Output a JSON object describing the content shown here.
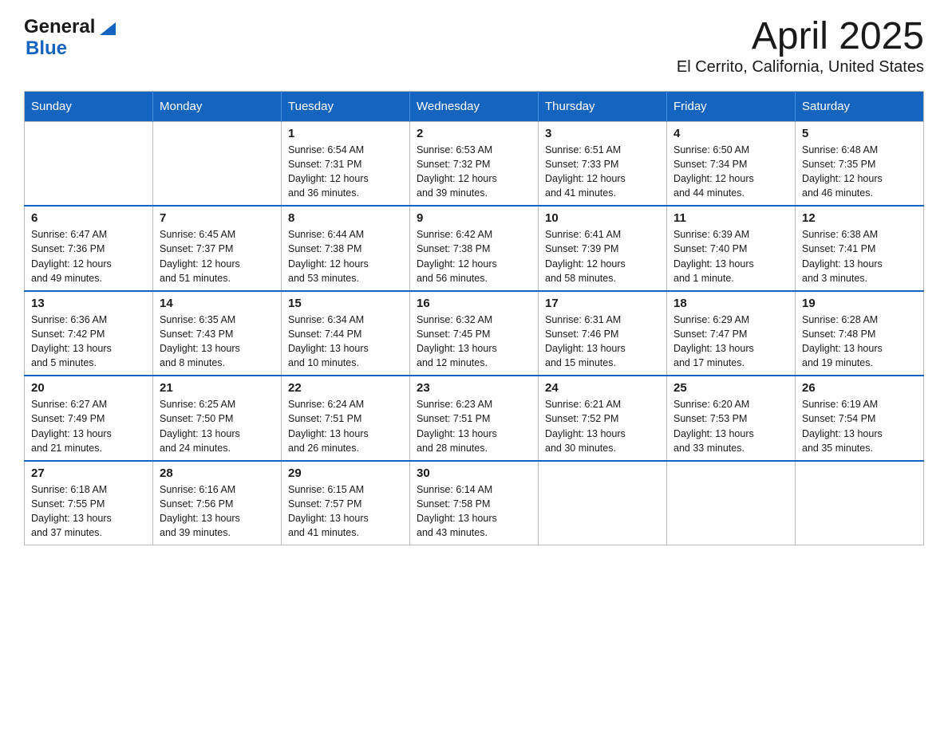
{
  "header": {
    "logo_general": "General",
    "logo_blue": "Blue",
    "title": "April 2025",
    "subtitle": "El Cerrito, California, United States"
  },
  "days_of_week": [
    "Sunday",
    "Monday",
    "Tuesday",
    "Wednesday",
    "Thursday",
    "Friday",
    "Saturday"
  ],
  "weeks": [
    [
      {
        "day": "",
        "info": ""
      },
      {
        "day": "",
        "info": ""
      },
      {
        "day": "1",
        "info": "Sunrise: 6:54 AM\nSunset: 7:31 PM\nDaylight: 12 hours\nand 36 minutes."
      },
      {
        "day": "2",
        "info": "Sunrise: 6:53 AM\nSunset: 7:32 PM\nDaylight: 12 hours\nand 39 minutes."
      },
      {
        "day": "3",
        "info": "Sunrise: 6:51 AM\nSunset: 7:33 PM\nDaylight: 12 hours\nand 41 minutes."
      },
      {
        "day": "4",
        "info": "Sunrise: 6:50 AM\nSunset: 7:34 PM\nDaylight: 12 hours\nand 44 minutes."
      },
      {
        "day": "5",
        "info": "Sunrise: 6:48 AM\nSunset: 7:35 PM\nDaylight: 12 hours\nand 46 minutes."
      }
    ],
    [
      {
        "day": "6",
        "info": "Sunrise: 6:47 AM\nSunset: 7:36 PM\nDaylight: 12 hours\nand 49 minutes."
      },
      {
        "day": "7",
        "info": "Sunrise: 6:45 AM\nSunset: 7:37 PM\nDaylight: 12 hours\nand 51 minutes."
      },
      {
        "day": "8",
        "info": "Sunrise: 6:44 AM\nSunset: 7:38 PM\nDaylight: 12 hours\nand 53 minutes."
      },
      {
        "day": "9",
        "info": "Sunrise: 6:42 AM\nSunset: 7:38 PM\nDaylight: 12 hours\nand 56 minutes."
      },
      {
        "day": "10",
        "info": "Sunrise: 6:41 AM\nSunset: 7:39 PM\nDaylight: 12 hours\nand 58 minutes."
      },
      {
        "day": "11",
        "info": "Sunrise: 6:39 AM\nSunset: 7:40 PM\nDaylight: 13 hours\nand 1 minute."
      },
      {
        "day": "12",
        "info": "Sunrise: 6:38 AM\nSunset: 7:41 PM\nDaylight: 13 hours\nand 3 minutes."
      }
    ],
    [
      {
        "day": "13",
        "info": "Sunrise: 6:36 AM\nSunset: 7:42 PM\nDaylight: 13 hours\nand 5 minutes."
      },
      {
        "day": "14",
        "info": "Sunrise: 6:35 AM\nSunset: 7:43 PM\nDaylight: 13 hours\nand 8 minutes."
      },
      {
        "day": "15",
        "info": "Sunrise: 6:34 AM\nSunset: 7:44 PM\nDaylight: 13 hours\nand 10 minutes."
      },
      {
        "day": "16",
        "info": "Sunrise: 6:32 AM\nSunset: 7:45 PM\nDaylight: 13 hours\nand 12 minutes."
      },
      {
        "day": "17",
        "info": "Sunrise: 6:31 AM\nSunset: 7:46 PM\nDaylight: 13 hours\nand 15 minutes."
      },
      {
        "day": "18",
        "info": "Sunrise: 6:29 AM\nSunset: 7:47 PM\nDaylight: 13 hours\nand 17 minutes."
      },
      {
        "day": "19",
        "info": "Sunrise: 6:28 AM\nSunset: 7:48 PM\nDaylight: 13 hours\nand 19 minutes."
      }
    ],
    [
      {
        "day": "20",
        "info": "Sunrise: 6:27 AM\nSunset: 7:49 PM\nDaylight: 13 hours\nand 21 minutes."
      },
      {
        "day": "21",
        "info": "Sunrise: 6:25 AM\nSunset: 7:50 PM\nDaylight: 13 hours\nand 24 minutes."
      },
      {
        "day": "22",
        "info": "Sunrise: 6:24 AM\nSunset: 7:51 PM\nDaylight: 13 hours\nand 26 minutes."
      },
      {
        "day": "23",
        "info": "Sunrise: 6:23 AM\nSunset: 7:51 PM\nDaylight: 13 hours\nand 28 minutes."
      },
      {
        "day": "24",
        "info": "Sunrise: 6:21 AM\nSunset: 7:52 PM\nDaylight: 13 hours\nand 30 minutes."
      },
      {
        "day": "25",
        "info": "Sunrise: 6:20 AM\nSunset: 7:53 PM\nDaylight: 13 hours\nand 33 minutes."
      },
      {
        "day": "26",
        "info": "Sunrise: 6:19 AM\nSunset: 7:54 PM\nDaylight: 13 hours\nand 35 minutes."
      }
    ],
    [
      {
        "day": "27",
        "info": "Sunrise: 6:18 AM\nSunset: 7:55 PM\nDaylight: 13 hours\nand 37 minutes."
      },
      {
        "day": "28",
        "info": "Sunrise: 6:16 AM\nSunset: 7:56 PM\nDaylight: 13 hours\nand 39 minutes."
      },
      {
        "day": "29",
        "info": "Sunrise: 6:15 AM\nSunset: 7:57 PM\nDaylight: 13 hours\nand 41 minutes."
      },
      {
        "day": "30",
        "info": "Sunrise: 6:14 AM\nSunset: 7:58 PM\nDaylight: 13 hours\nand 43 minutes."
      },
      {
        "day": "",
        "info": ""
      },
      {
        "day": "",
        "info": ""
      },
      {
        "day": "",
        "info": ""
      }
    ]
  ]
}
